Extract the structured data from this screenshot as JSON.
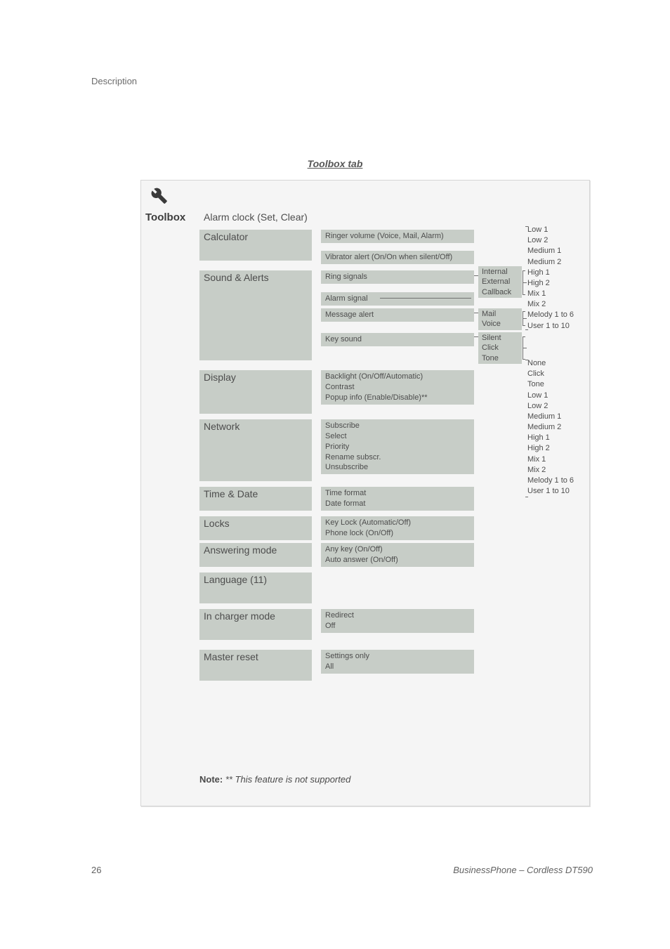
{
  "page_header_label": "Description",
  "section_title": "Toolbox tab",
  "toolbox_label": "Toolbox",
  "wrench_icon_name": "wrench-icon",
  "col1": {
    "alarm_clock": "Alarm clock (Set, Clear)",
    "calculator": "Calculator",
    "sound_alerts": "Sound & Alerts",
    "display": "Display",
    "network": "Network",
    "time_date": "Time & Date",
    "locks": "Locks",
    "answering_mode": "Answering mode",
    "language": "Language (11)",
    "in_charger_mode": "In charger mode",
    "master_reset": "Master reset"
  },
  "col2": {
    "ringer_volume": "Ringer volume (Voice, Mail, Alarm)",
    "vibrator_alert": "Vibrator alert (On/On when silent/Off)",
    "ring_signals": "Ring signals",
    "alarm_signal": "Alarm signal",
    "message_alert": "Message alert",
    "key_sound": "Key sound",
    "display_lines": "Backlight (On/Off/Automatic)\nContrast\nPopup info (Enable/Disable)**",
    "network_lines": "Subscribe\nSelect\nPriority\nRename subscr.\nUnsubscribe",
    "time_date_lines": "Time format\nDate format",
    "locks_lines": "Key Lock (Automatic/Off)\nPhone lock (On/Off)",
    "answering_lines": "Any key (On/Off)\nAuto answer (On/Off)",
    "in_charger_lines": "Redirect\nOff",
    "master_reset_lines": "Settings only\nAll"
  },
  "col3": {
    "ring_targets": "Internal\nExternal\nCallback",
    "message_targets": "Mail\nVoice",
    "key_sound_opts": "Silent\nClick\nTone"
  },
  "col4": {
    "volume_levels": "Low 1\nLow 2\nMedium 1\nMedium 2\nHigh 1\nHigh 2\nMix 1\nMix 2\nMelody 1 to 6\nUser 1 to 10",
    "key_sound_levels": "None\nClick\nTone\nLow 1\nLow 2\nMedium 1\nMedium 2\nHigh 1\nHigh 2\nMix 1\nMix 2\nMelody 1 to 6\nUser 1 to 10"
  },
  "note": {
    "prefix": "Note: ",
    "stars": "** ",
    "text": "This feature is not supported"
  },
  "footer": {
    "page": "26",
    "product": "BusinessPhone – Cordless DT590"
  }
}
